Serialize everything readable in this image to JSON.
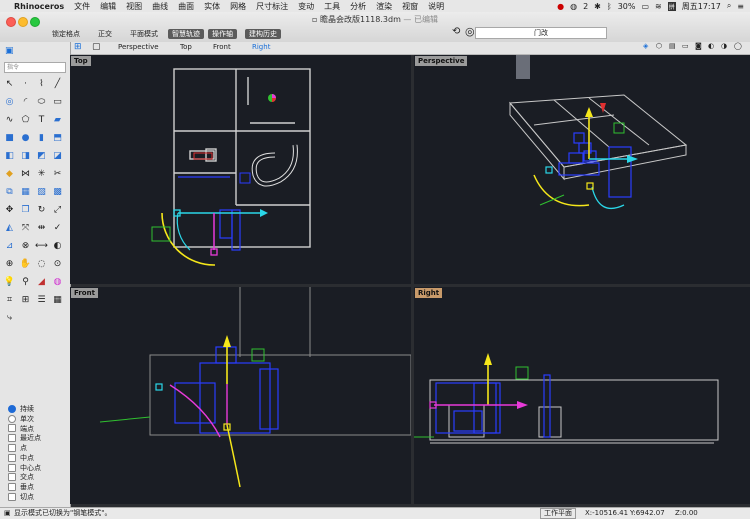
{
  "menubar": {
    "app_name": "Rhinoceros",
    "items": [
      "文件",
      "编辑",
      "视图",
      "曲线",
      "曲面",
      "实体",
      "网格",
      "尺寸标注",
      "变动",
      "工具",
      "分析",
      "渲染",
      "视窗",
      "说明"
    ],
    "status_right": {
      "wechat_count": "2",
      "battery": "30%",
      "clock": "周五17:17"
    }
  },
  "window": {
    "title": "瞻晶会改版1118.3dm",
    "title_suffix": "— 已编辑",
    "toolbar": {
      "lock_grid": "锁定格点",
      "ortho": "正交",
      "planar": "平面模式",
      "smart_track": "智慧轨迹",
      "gumball": "操作轴",
      "history": "建构历史"
    },
    "command_value": "门改"
  },
  "viewport_tabs": {
    "items": [
      "Perspective",
      "Top",
      "Front",
      "Right"
    ],
    "active": "Right"
  },
  "panel": {
    "search_placeholder": "指令",
    "osnap": {
      "items": [
        {
          "label": "持续",
          "selected": true
        },
        {
          "label": "单次",
          "selected": false
        },
        {
          "label": "端点",
          "selected": false
        },
        {
          "label": "最近点",
          "selected": false
        },
        {
          "label": "点",
          "selected": false
        },
        {
          "label": "中点",
          "selected": false
        },
        {
          "label": "中心点",
          "selected": false
        },
        {
          "label": "交点",
          "selected": false
        },
        {
          "label": "垂点",
          "selected": false
        },
        {
          "label": "切点",
          "selected": false
        }
      ]
    }
  },
  "viewports": {
    "top": {
      "label": "Top"
    },
    "perspective": {
      "label": "Perspective"
    },
    "front": {
      "label": "Front"
    },
    "right": {
      "label": "Right"
    }
  },
  "statusbar": {
    "message": "显示模式已切换为\"钢笔模式\"。",
    "cplane": "工作平面",
    "x": "X:-10516.41",
    "y": "Y:6942.07",
    "z": "Z:0.00"
  },
  "colors": {
    "axis_yellow": "#f5e71a",
    "axis_cyan": "#2ad7e8",
    "axis_magenta": "#e83ad9",
    "selection_blue": "#2a3cff",
    "viewport_bg": "#1a1d24",
    "grid_line": "#c8c8c8"
  }
}
